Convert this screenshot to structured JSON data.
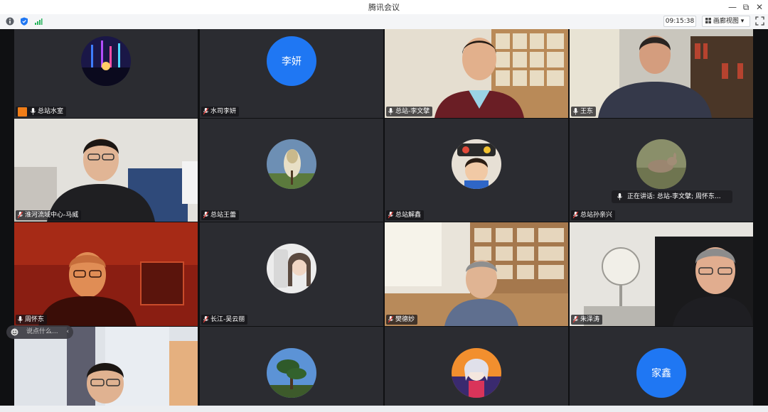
{
  "window": {
    "title": "腾讯会议",
    "minimize": "—",
    "restore": "⧉",
    "close": "✕"
  },
  "toolbar": {
    "info_icon": "info-icon",
    "shield_icon": "shield-icon",
    "signal_icon": "signal-icon",
    "timer": "09:15:38",
    "view_label": "画廊视图",
    "view_caret": "▾"
  },
  "colors": {
    "accent": "#1f77f3",
    "host": "#f07d17",
    "tile_bg": "#2b2c31"
  },
  "participants": [
    {
      "name": "总站水室",
      "avatar": "concert-photo",
      "host": true
    },
    {
      "name": "水司李妍",
      "avatar_text": "李妍"
    },
    {
      "name": "总站-李文擘",
      "avatar": "video"
    },
    {
      "name": "王东",
      "avatar": "video"
    },
    {
      "name": "淮河流域中心-马威",
      "avatar": "video"
    },
    {
      "name": "总站王蕾",
      "avatar": "flower-photo"
    },
    {
      "name": "总站解鑫",
      "avatar": "child-photo"
    },
    {
      "name": "总站孙亲兴",
      "avatar": "animal-photo"
    },
    {
      "name": "周怀东",
      "avatar": "video"
    },
    {
      "name": "长江-吴云丽",
      "avatar": "portrait-photo"
    },
    {
      "name": "樊德妙",
      "avatar": "video"
    },
    {
      "name": "朱泽涛",
      "avatar": "video"
    },
    {
      "name": "",
      "avatar": "video"
    },
    {
      "name": "",
      "avatar": "tree-photo"
    },
    {
      "name": "",
      "avatar": "anime-photo"
    },
    {
      "name": "",
      "avatar_text": "家鑫"
    }
  ],
  "speaking": {
    "text": "正在讲话: 总站-李文擘; 周怀东..."
  },
  "chat": {
    "placeholder": "说点什么...",
    "chevron": "‹"
  }
}
